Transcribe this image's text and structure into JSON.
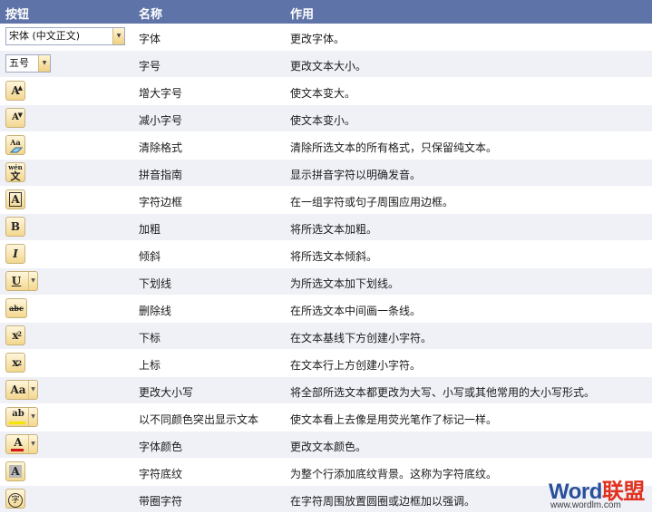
{
  "header": {
    "col_button": "按钮",
    "col_name": "名称",
    "col_usage": "作用"
  },
  "rows": [
    {
      "icon": "font-combo",
      "control_text": "宋体 (中文正文)",
      "name": "字体",
      "usage": "更改字体。"
    },
    {
      "icon": "font-size-combo",
      "control_text": "五号",
      "name": "字号",
      "usage": "更改文本大小。"
    },
    {
      "icon": "grow-font-icon",
      "control_text": "A",
      "name": "增大字号",
      "usage": "使文本变大。"
    },
    {
      "icon": "shrink-font-icon",
      "control_text": "A",
      "name": "减小字号",
      "usage": "使文本变小。"
    },
    {
      "icon": "clear-formatting-icon",
      "control_text": "Aa",
      "name": "清除格式",
      "usage": "清除所选文本的所有格式，只保留纯文本。"
    },
    {
      "icon": "phonetic-guide-icon",
      "control_text": "wén",
      "name": "拼音指南",
      "usage": "显示拼音字符以明确发音。"
    },
    {
      "icon": "character-border-icon",
      "control_text": "A",
      "name": "字符边框",
      "usage": "在一组字符或句子周围应用边框。"
    },
    {
      "icon": "bold-icon",
      "control_text": "B",
      "name": "加粗",
      "usage": "将所选文本加粗。"
    },
    {
      "icon": "italic-icon",
      "control_text": "I",
      "name": "倾斜",
      "usage": "将所选文本倾斜。"
    },
    {
      "icon": "underline-icon",
      "control_text": "U",
      "name": "下划线",
      "usage": "为所选文本加下划线。"
    },
    {
      "icon": "strikethrough-icon",
      "control_text": "abc",
      "name": "删除线",
      "usage": "在所选文本中间画一条线。"
    },
    {
      "icon": "subscript-icon",
      "control_text": "x",
      "name": "下标",
      "usage": "在文本基线下方创建小字符。"
    },
    {
      "icon": "superscript-icon",
      "control_text": "x",
      "name": "上标",
      "usage": "在文本行上方创建小字符。"
    },
    {
      "icon": "change-case-icon",
      "control_text": "Aa",
      "name": "更改大小写",
      "usage": "将全部所选文本都更改为大写、小写或其他常用的大小写形式。"
    },
    {
      "icon": "highlight-icon",
      "control_text": "ab",
      "name": "以不同颜色突出显示文本",
      "usage": "使文本看上去像是用荧光笔作了标记一样。"
    },
    {
      "icon": "font-color-icon",
      "control_text": "A",
      "name": "字体颜色",
      "usage": "更改文本颜色。"
    },
    {
      "icon": "character-shading-icon",
      "control_text": "A",
      "name": "字符底纹",
      "usage": "为整个行添加底纹背景。这称为字符底纹。"
    },
    {
      "icon": "enclose-characters-icon",
      "control_text": "字",
      "name": "带圈字符",
      "usage": "在字符周围放置圆圈或边框加以强调。"
    }
  ],
  "watermark": {
    "brand_word": "Word",
    "brand_cn": "联盟",
    "url": "www.wordlm.com"
  },
  "colors": {
    "header_bg": "#5e73a7",
    "row_alt_bg": "#eff1f7",
    "icon_gold": "#f3d78e",
    "watermark_blue": "#2a4f9a",
    "watermark_red": "#e0311f"
  }
}
